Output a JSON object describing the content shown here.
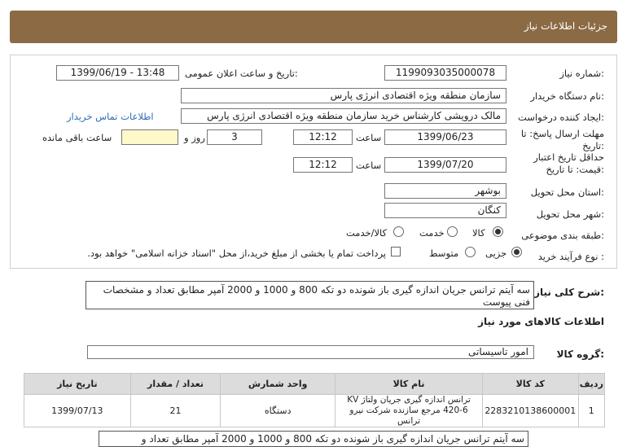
{
  "header": {
    "title": "جزئیات اطلاعات نیاز"
  },
  "form": {
    "need_number_label": "شماره نیاز:",
    "need_number": "1199093035000078",
    "announce_label": "تاریخ و ساعت اعلان عمومی:",
    "announce_value": "1399/06/19 - 13:48",
    "buyer_label": "نام دستگاه خریدار:",
    "buyer_value": "سازمان منطقه ویژه اقتصادی انرژی پارس",
    "creator_label": "ایجاد کننده درخواست:",
    "creator_value": "مالک  درویشی کارشناس خرید سازمان منطقه ویژه اقتصادی انرژی پارس",
    "contact_link": "اطلاعات تماس خریدار",
    "deadline_label_1": "مهلت ارسال پاسخ: تا",
    "deadline_label_2": "تاریخ:",
    "deadline_date": "1399/06/23",
    "time_word": "ساعت",
    "deadline_time": "12:12",
    "days_value": "3",
    "days_word": "روز و",
    "remaining_word": "ساعت باقی مانده",
    "remaining_value": "",
    "validity_label_1": "حداقل تاریخ اعتبار",
    "validity_label_2": "قیمت: تا تاریخ:",
    "validity_date": "1399/07/20",
    "validity_time": "12:12",
    "province_label": "استان محل تحویل:",
    "province_value": "بوشهر",
    "city_label": "شهر محل تحویل:",
    "city_value": "کنگان",
    "category_label": "طبقه بندی موضوعی:",
    "category_options": [
      "کالا",
      "خدمت",
      "کالا/خدمت"
    ],
    "purchase_label": "نوع فرآیند خرید :",
    "purchase_options": [
      "جزیی",
      "متوسط"
    ],
    "payment_note": "پرداخت تمام یا بخشی از مبلغ خرید،از محل \"اسناد خزانه اسلامی\" خواهد بود."
  },
  "summary": {
    "label": "شرح کلی نیاز:",
    "text": "سه آیتم ترانس جریان اندازه گیری باز شونده دو تکه 800 و 1000 و 2000 آمپر مطابق تعداد و مشخصات فنی پیوست"
  },
  "goods_info": {
    "title": "اطلاعات کالاهای مورد نیاز",
    "group_label": "گروه کالا:",
    "group_value": "امور تاسیساتی"
  },
  "table": {
    "headers": [
      "ردیف",
      "کد کالا",
      "نام کالا",
      "واحد شمارش",
      "تعداد / مقدار",
      "تاریخ نیاز"
    ],
    "rows": [
      {
        "row": "1",
        "code": "2283210138600001",
        "name": "ترانس اندازه گیری جریان ولتاژ KV 420-6 مرجع سازنده شرکت نیرو ترانس",
        "unit": "دستگاه",
        "qty": "21",
        "date": "1399/07/13"
      }
    ]
  },
  "bottom_note": {
    "text": "سه آیتم ترانس جریان اندازه گیری باز شونده دو تکه 800 و 1000 و 2000 آمپر مطابق تعداد و مشخصات"
  },
  "colors": {
    "header_bg": "#8b6a44",
    "highlight": "#fff8c9",
    "link": "#2f6db5"
  }
}
